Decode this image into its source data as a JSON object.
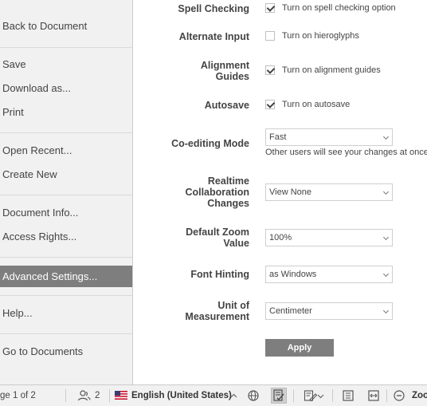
{
  "sidebar": {
    "items": [
      {
        "label": "Back to Document"
      },
      {
        "label": "Save"
      },
      {
        "label": "Download as..."
      },
      {
        "label": "Print"
      },
      {
        "label": "Open Recent..."
      },
      {
        "label": "Create New"
      },
      {
        "label": "Document Info..."
      },
      {
        "label": "Access Rights..."
      },
      {
        "label": "Advanced Settings..."
      },
      {
        "label": "Help..."
      },
      {
        "label": "Go to Documents"
      }
    ]
  },
  "settings": {
    "spell_checking": {
      "label": "Spell Checking",
      "option": "Turn on spell checking option",
      "checked": true
    },
    "alternate_input": {
      "label": "Alternate Input",
      "option": "Turn on hieroglyphs",
      "checked": false
    },
    "alignment_guides": {
      "label_1": "Alignment",
      "label_2": "Guides",
      "option": "Turn on alignment guides",
      "checked": true
    },
    "autosave": {
      "label": "Autosave",
      "option": "Turn on autosave",
      "checked": true
    },
    "coediting": {
      "label": "Co-editing Mode",
      "value": "Fast",
      "hint": "Other users will see your changes at once"
    },
    "realtime": {
      "label_1": "Realtime",
      "label_2": "Collaboration",
      "label_3": "Changes",
      "value": "View None"
    },
    "zoom": {
      "label_1": "Default Zoom",
      "label_2": "Value",
      "value": "100%"
    },
    "font_hinting": {
      "label": "Font Hinting",
      "value": "as Windows"
    },
    "unit": {
      "label_1": "Unit of",
      "label_2": "Measurement",
      "value": "Centimeter"
    },
    "apply_label": "Apply"
  },
  "statusbar": {
    "page": "ge 1 of 2",
    "users_count": "2",
    "language": "English (United States)",
    "zoom_label": "Zoo"
  },
  "colors": {
    "active_item": "#7e7e7e",
    "sidebar_bg": "#f1f1f1"
  }
}
